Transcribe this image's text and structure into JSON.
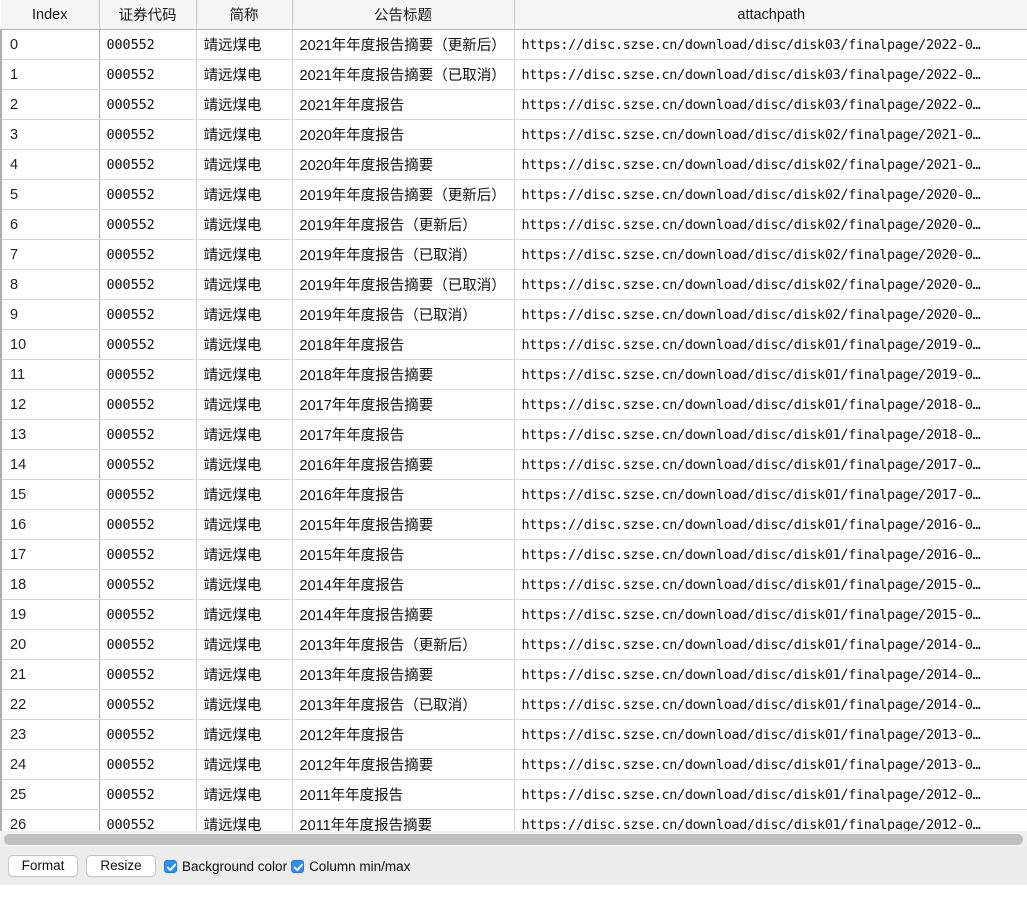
{
  "table": {
    "columns": [
      {
        "key": "index",
        "label": "Index"
      },
      {
        "key": "code",
        "label": "证券代码"
      },
      {
        "key": "name",
        "label": "简称"
      },
      {
        "key": "title",
        "label": "公告标题"
      },
      {
        "key": "attachpath",
        "label": "attachpath"
      }
    ],
    "rows": [
      {
        "index": "0",
        "code": "000552",
        "name": "靖远煤电",
        "title": "2021年年度报告摘要（更新后）",
        "attachpath": "https://disc.szse.cn/download/disc/disk03/finalpage/2022-0…"
      },
      {
        "index": "1",
        "code": "000552",
        "name": "靖远煤电",
        "title": "2021年年度报告摘要（已取消）",
        "attachpath": "https://disc.szse.cn/download/disc/disk03/finalpage/2022-0…"
      },
      {
        "index": "2",
        "code": "000552",
        "name": "靖远煤电",
        "title": "2021年年度报告",
        "attachpath": "https://disc.szse.cn/download/disc/disk03/finalpage/2022-0…"
      },
      {
        "index": "3",
        "code": "000552",
        "name": "靖远煤电",
        "title": "2020年年度报告",
        "attachpath": "https://disc.szse.cn/download/disc/disk02/finalpage/2021-0…"
      },
      {
        "index": "4",
        "code": "000552",
        "name": "靖远煤电",
        "title": "2020年年度报告摘要",
        "attachpath": "https://disc.szse.cn/download/disc/disk02/finalpage/2021-0…"
      },
      {
        "index": "5",
        "code": "000552",
        "name": "靖远煤电",
        "title": "2019年年度报告摘要（更新后）",
        "attachpath": "https://disc.szse.cn/download/disc/disk02/finalpage/2020-0…"
      },
      {
        "index": "6",
        "code": "000552",
        "name": "靖远煤电",
        "title": "2019年年度报告（更新后）",
        "attachpath": "https://disc.szse.cn/download/disc/disk02/finalpage/2020-0…"
      },
      {
        "index": "7",
        "code": "000552",
        "name": "靖远煤电",
        "title": "2019年年度报告（已取消）",
        "attachpath": "https://disc.szse.cn/download/disc/disk02/finalpage/2020-0…"
      },
      {
        "index": "8",
        "code": "000552",
        "name": "靖远煤电",
        "title": "2019年年度报告摘要（已取消）",
        "attachpath": "https://disc.szse.cn/download/disc/disk02/finalpage/2020-0…"
      },
      {
        "index": "9",
        "code": "000552",
        "name": "靖远煤电",
        "title": "2019年年度报告（已取消）",
        "attachpath": "https://disc.szse.cn/download/disc/disk02/finalpage/2020-0…"
      },
      {
        "index": "10",
        "code": "000552",
        "name": "靖远煤电",
        "title": "2018年年度报告",
        "attachpath": "https://disc.szse.cn/download/disc/disk01/finalpage/2019-0…"
      },
      {
        "index": "11",
        "code": "000552",
        "name": "靖远煤电",
        "title": "2018年年度报告摘要",
        "attachpath": "https://disc.szse.cn/download/disc/disk01/finalpage/2019-0…"
      },
      {
        "index": "12",
        "code": "000552",
        "name": "靖远煤电",
        "title": "2017年年度报告摘要",
        "attachpath": "https://disc.szse.cn/download/disc/disk01/finalpage/2018-0…"
      },
      {
        "index": "13",
        "code": "000552",
        "name": "靖远煤电",
        "title": "2017年年度报告",
        "attachpath": "https://disc.szse.cn/download/disc/disk01/finalpage/2018-0…"
      },
      {
        "index": "14",
        "code": "000552",
        "name": "靖远煤电",
        "title": "2016年年度报告摘要",
        "attachpath": "https://disc.szse.cn/download/disc/disk01/finalpage/2017-0…"
      },
      {
        "index": "15",
        "code": "000552",
        "name": "靖远煤电",
        "title": "2016年年度报告",
        "attachpath": "https://disc.szse.cn/download/disc/disk01/finalpage/2017-0…"
      },
      {
        "index": "16",
        "code": "000552",
        "name": "靖远煤电",
        "title": "2015年年度报告摘要",
        "attachpath": "https://disc.szse.cn/download/disc/disk01/finalpage/2016-0…"
      },
      {
        "index": "17",
        "code": "000552",
        "name": "靖远煤电",
        "title": "2015年年度报告",
        "attachpath": "https://disc.szse.cn/download/disc/disk01/finalpage/2016-0…"
      },
      {
        "index": "18",
        "code": "000552",
        "name": "靖远煤电",
        "title": "2014年年度报告",
        "attachpath": "https://disc.szse.cn/download/disc/disk01/finalpage/2015-0…"
      },
      {
        "index": "19",
        "code": "000552",
        "name": "靖远煤电",
        "title": "2014年年度报告摘要",
        "attachpath": "https://disc.szse.cn/download/disc/disk01/finalpage/2015-0…"
      },
      {
        "index": "20",
        "code": "000552",
        "name": "靖远煤电",
        "title": "2013年年度报告（更新后）",
        "attachpath": "https://disc.szse.cn/download/disc/disk01/finalpage/2014-0…"
      },
      {
        "index": "21",
        "code": "000552",
        "name": "靖远煤电",
        "title": "2013年年度报告摘要",
        "attachpath": "https://disc.szse.cn/download/disc/disk01/finalpage/2014-0…"
      },
      {
        "index": "22",
        "code": "000552",
        "name": "靖远煤电",
        "title": "2013年年度报告（已取消）",
        "attachpath": "https://disc.szse.cn/download/disc/disk01/finalpage/2014-0…"
      },
      {
        "index": "23",
        "code": "000552",
        "name": "靖远煤电",
        "title": "2012年年度报告",
        "attachpath": "https://disc.szse.cn/download/disc/disk01/finalpage/2013-0…"
      },
      {
        "index": "24",
        "code": "000552",
        "name": "靖远煤电",
        "title": "2012年年度报告摘要",
        "attachpath": "https://disc.szse.cn/download/disc/disk01/finalpage/2013-0…"
      },
      {
        "index": "25",
        "code": "000552",
        "name": "靖远煤电",
        "title": "2011年年度报告",
        "attachpath": "https://disc.szse.cn/download/disc/disk01/finalpage/2012-0…"
      },
      {
        "index": "26",
        "code": "000552",
        "name": "靖远煤电",
        "title": "2011年年度报告摘要",
        "attachpath": "https://disc.szse.cn/download/disc/disk01/finalpage/2012-0…"
      }
    ]
  },
  "toolbar": {
    "format_button": "Format",
    "resize_button": "Resize",
    "background_color_checkbox": {
      "label": "Background color",
      "checked": true
    },
    "column_minmax_checkbox": {
      "label": "Column min/max",
      "checked": true
    }
  },
  "colors": {
    "header_background": "#f5f5f5",
    "row_background": "#ffffff",
    "grid_line": "#d8d8d8",
    "toolbar_background": "#ececec",
    "checkbox_accent": "#2f8ef4",
    "scrollbar_thumb": "#bfbfbf"
  }
}
